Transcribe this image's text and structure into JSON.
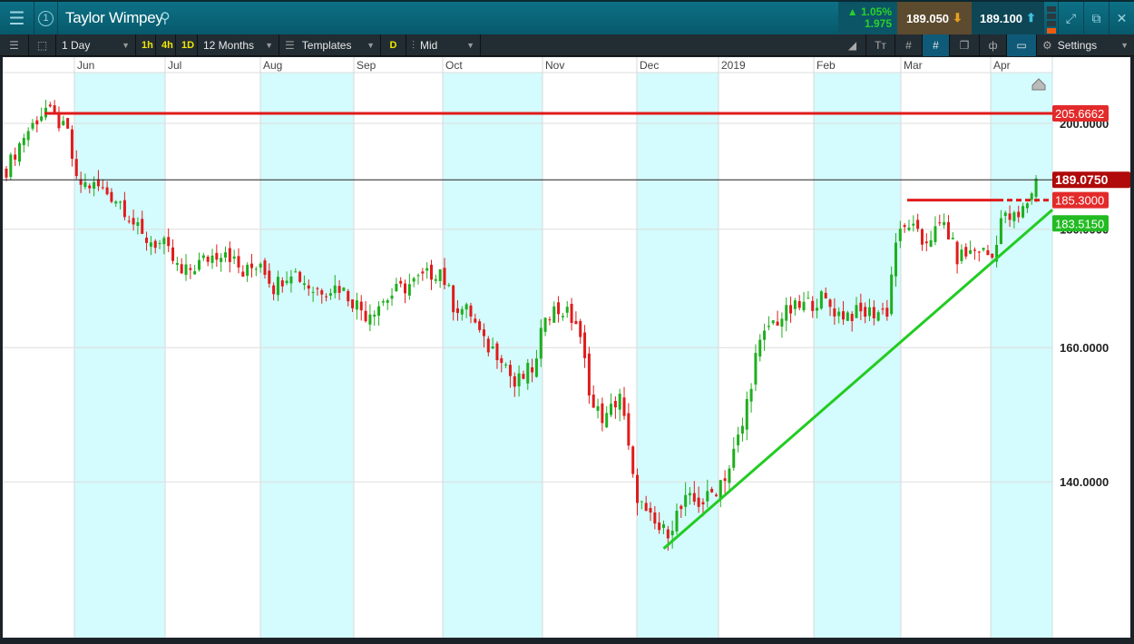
{
  "header": {
    "title": "Taylor Wimpey",
    "change_pct": "▲ 1.05%",
    "change_abs": "1.975",
    "sell": "189.050",
    "buy": "189.100"
  },
  "toolbar": {
    "interval": "1 Day",
    "q1": "1h",
    "q2": "4h",
    "q3": "1D",
    "range": "12 Months",
    "templates": "Templates",
    "d": "D",
    "price_type": "Mid",
    "settings": "Settings"
  },
  "chart_data": {
    "type": "candlestick",
    "instrument": "Taylor Wimpey",
    "x_labels": [
      "Jun",
      "Jul",
      "Aug",
      "Sep",
      "Oct",
      "Nov",
      "Dec",
      "2019",
      "Feb",
      "Mar",
      "Apr"
    ],
    "y_ticks": [
      "200.0000",
      "180.0000",
      "160.0000",
      "140.0000"
    ],
    "close_path": [
      [
        0,
        191
      ],
      [
        4,
        197.5
      ],
      [
        9,
        203
      ],
      [
        14,
        198
      ],
      [
        16,
        188.5
      ],
      [
        21,
        187.7
      ],
      [
        26,
        185
      ],
      [
        31,
        178.5
      ],
      [
        36,
        177
      ],
      [
        40,
        172
      ],
      [
        45,
        174.5
      ],
      [
        50,
        176.5
      ],
      [
        54,
        172
      ],
      [
        58,
        174.5
      ],
      [
        61,
        170
      ],
      [
        65,
        173
      ],
      [
        70,
        169.5
      ],
      [
        76,
        170
      ],
      [
        82,
        165.5
      ],
      [
        89,
        169.2
      ],
      [
        95,
        171.5
      ],
      [
        99,
        173
      ],
      [
        102,
        167
      ],
      [
        106,
        165.5
      ],
      [
        109,
        160.5
      ],
      [
        113,
        159
      ],
      [
        116,
        154
      ],
      [
        121,
        157.5
      ],
      [
        123,
        166
      ],
      [
        127,
        166
      ],
      [
        130,
        164
      ],
      [
        132,
        157.5
      ],
      [
        134,
        150.5
      ],
      [
        137,
        149
      ],
      [
        140,
        153
      ],
      [
        143,
        140
      ],
      [
        146,
        135
      ],
      [
        150,
        133
      ],
      [
        155,
        137
      ],
      [
        160,
        137.5
      ],
      [
        165,
        142
      ],
      [
        168,
        148
      ],
      [
        171,
        158.5
      ],
      [
        174,
        163.5
      ],
      [
        179,
        166
      ],
      [
        186,
        168
      ],
      [
        190,
        165.5
      ],
      [
        195,
        165.5
      ],
      [
        201,
        166
      ],
      [
        203,
        178
      ],
      [
        206,
        181
      ],
      [
        209,
        177.5
      ],
      [
        214,
        181
      ],
      [
        217,
        175
      ],
      [
        222,
        176.5
      ],
      [
        225,
        175
      ],
      [
        227,
        182
      ],
      [
        231,
        182
      ],
      [
        233,
        185
      ],
      [
        235,
        189
      ]
    ],
    "levels": {
      "resistance": "205.6662",
      "current": "189.0750",
      "short_resistance": "185.3000",
      "trendline": "183.5150"
    },
    "trendline_points": [
      [
        150,
        131
      ],
      [
        239,
        183.515
      ]
    ]
  }
}
